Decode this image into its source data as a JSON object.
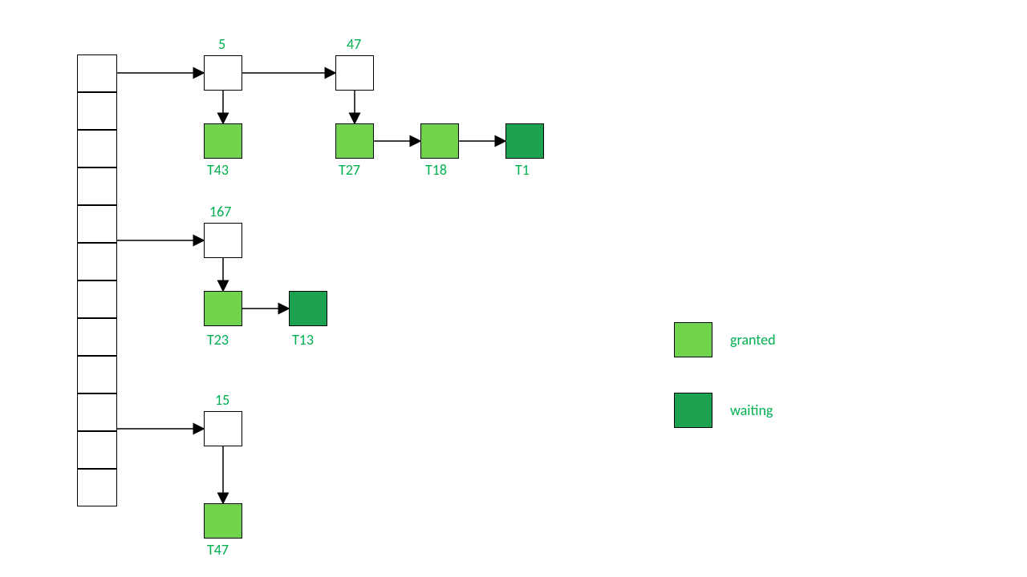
{
  "colors": {
    "text": "#00B050",
    "granted": "#70D34B",
    "waiting": "#1CA24F"
  },
  "hash_table": {
    "slots": 12
  },
  "chains": [
    {
      "from_slot_index": 0,
      "buckets": [
        {
          "key": "5",
          "transactions": [
            {
              "id": "T43",
              "state": "granted"
            }
          ]
        },
        {
          "key": "47",
          "transactions": [
            {
              "id": "T27",
              "state": "granted"
            },
            {
              "id": "T18",
              "state": "granted"
            },
            {
              "id": "T1",
              "state": "waiting"
            }
          ]
        }
      ]
    },
    {
      "from_slot_index": 4,
      "buckets": [
        {
          "key": "167",
          "transactions": [
            {
              "id": "T23",
              "state": "granted"
            },
            {
              "id": "T13",
              "state": "waiting"
            }
          ]
        }
      ]
    },
    {
      "from_slot_index": 9,
      "buckets": [
        {
          "key": "15",
          "transactions": [
            {
              "id": "T47",
              "state": "granted"
            }
          ]
        }
      ]
    }
  ],
  "legend": {
    "granted_label": "granted",
    "waiting_label": "waiting"
  }
}
